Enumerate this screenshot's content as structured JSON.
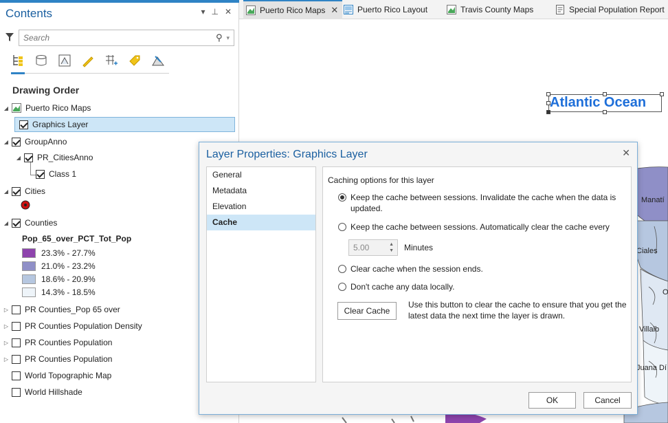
{
  "contents": {
    "title": "Contents",
    "ctrl_menu": "▾",
    "ctrl_pin": "⊥",
    "ctrl_close": "✕",
    "search_placeholder": "Search",
    "drawing_order": "Drawing Order",
    "map_name": "Puerto Rico Maps",
    "layers": {
      "graphics": "Graphics Layer",
      "group_anno": "GroupAnno",
      "pr_cities_anno": "PR_CitiesAnno",
      "class1": "Class 1",
      "cities": "Cities",
      "counties": "Counties",
      "counties_field": "Pop_65_over_PCT_Tot_Pop",
      "pr_pop65": "PR Counties_Pop 65 over",
      "pr_density": "PR Counties Population Density",
      "pr_pop_a": "PR Counties Population",
      "pr_pop_b": "PR Counties Population",
      "world_topo": "World Topographic Map",
      "world_hill": "World Hillshade"
    },
    "legend": [
      {
        "label": "23.3% - 27.7%",
        "color": "#8e44ad"
      },
      {
        "label": "21.0% - 23.2%",
        "color": "#8f8fc7"
      },
      {
        "label": "18.6% - 20.9%",
        "color": "#b6c7e0"
      },
      {
        "label": "14.3% - 18.5%",
        "color": "#eef4f9"
      }
    ]
  },
  "tabs": [
    {
      "label": "Puerto Rico Maps",
      "close": "✕"
    },
    {
      "label": "Puerto Rico Layout"
    },
    {
      "label": "Travis County Maps"
    },
    {
      "label": "Special Population Report"
    }
  ],
  "map": {
    "ocean_label": "Atlantic Ocean",
    "towns": [
      "Manatí",
      "Ciales",
      "O",
      "Villalb",
      "Juana Dí"
    ]
  },
  "dialog": {
    "title": "Layer Properties: Graphics Layer",
    "close": "✕",
    "nav": [
      "General",
      "Metadata",
      "Elevation",
      "Cache"
    ],
    "caching_title": "Caching options for this layer",
    "option1": "Keep the cache between sessions. Invalidate the cache when the data is updated.",
    "option2": "Keep the cache between sessions. Automatically clear the cache every",
    "minutes_value": "5.00",
    "minutes_label": "Minutes",
    "option3": "Clear cache when the session ends.",
    "option4": "Don't cache any data locally.",
    "clear_button": "Clear Cache",
    "clear_desc": "Use this button to clear the cache to ensure that you get the latest data the next time the layer is drawn.",
    "ok": "OK",
    "cancel": "Cancel"
  },
  "colors": {
    "accent": "#2f83c5",
    "title_blue": "#1a5fa0",
    "ocean_label": "#1e6fd9",
    "selection": "#cde6f7",
    "city_symbol": "#cc1111"
  }
}
